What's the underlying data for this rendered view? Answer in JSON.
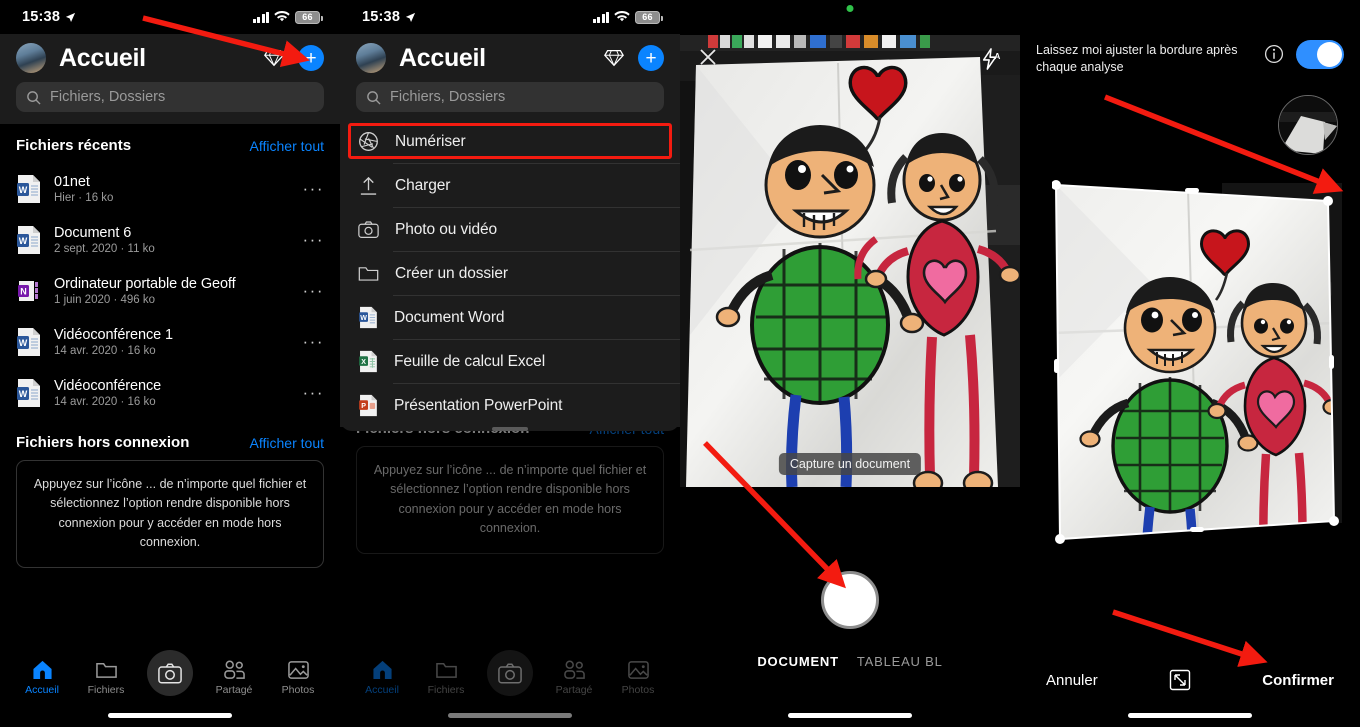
{
  "status_bar": {
    "time": "15:38",
    "battery": "66",
    "location_icon": "location-arrow-icon",
    "signal_icon": "cellular-bars-icon",
    "wifi_icon": "wifi-icon"
  },
  "panel1": {
    "header": {
      "title": "Accueil",
      "avatar": "user-avatar",
      "premium_icon": "diamond-icon",
      "add_label": "+"
    },
    "search": {
      "placeholder": "Fichiers, Dossiers",
      "icon": "search-icon"
    },
    "recent": {
      "title": "Fichiers récents",
      "see_all": "Afficher tout"
    },
    "files": [
      {
        "name": "01net",
        "sub": "Hier · 16 ko",
        "icon": "word-file-icon",
        "more": "···"
      },
      {
        "name": "Document 6",
        "sub": "2 sept. 2020 · 11 ko",
        "icon": "word-file-icon",
        "more": "···"
      },
      {
        "name": "Ordinateur portable de Geoff",
        "sub": "1 juin 2020 · 496 ko",
        "icon": "onenote-file-icon",
        "more": "···"
      },
      {
        "name": "Vidéoconférence 1",
        "sub": "14 avr. 2020 · 16 ko",
        "icon": "word-file-icon",
        "more": "···"
      },
      {
        "name": "Vidéoconférence",
        "sub": "14 avr. 2020 · 16 ko",
        "icon": "word-file-icon",
        "more": "···"
      }
    ],
    "offline": {
      "title": "Fichiers hors connexion",
      "see_all": "Afficher tout",
      "empty_text": "Appuyez sur l’icône ... de n’importe quel fichier et sélectionnez l’option rendre disponible hors connexion pour y accéder en mode hors connexion."
    },
    "tabs": [
      {
        "label": "Accueil",
        "icon": "home-icon",
        "active": true
      },
      {
        "label": "Fichiers",
        "icon": "folder-icon",
        "active": false
      },
      {
        "label": "",
        "icon": "camera-icon",
        "active": false
      },
      {
        "label": "Partagé",
        "icon": "people-icon",
        "active": false
      },
      {
        "label": "Photos",
        "icon": "photo-icon",
        "active": false
      }
    ]
  },
  "panel2": {
    "menu_items": [
      {
        "label": "Numériser",
        "icon": "aperture-scan-icon",
        "highlighted": true
      },
      {
        "label": "Charger",
        "icon": "upload-arrow-icon",
        "highlighted": false
      },
      {
        "label": "Photo ou vidéo",
        "icon": "camera-outline-icon",
        "highlighted": false
      },
      {
        "label": "Créer un dossier",
        "icon": "folder-outline-icon",
        "highlighted": false
      },
      {
        "label": "Document Word",
        "icon": "word-file-icon",
        "highlighted": false
      },
      {
        "label": "Feuille de calcul Excel",
        "icon": "excel-file-icon",
        "highlighted": false
      },
      {
        "label": "Présentation PowerPoint",
        "icon": "powerpoint-file-icon",
        "highlighted": false
      }
    ]
  },
  "panel3": {
    "close_icon": "close-icon",
    "flash_icon": "flash-auto-icon",
    "hint": "Capture un document",
    "shutter": "shutter-button",
    "modes": [
      {
        "label": "DOCUMENT",
        "active": true
      },
      {
        "label": "TABLEAU BL",
        "active": false
      }
    ],
    "recording_indicator": "green-privacy-dot"
  },
  "panel4": {
    "toggle_label": "Laissez moi ajuster la bordure après chaque analyse",
    "info_icon": "info-circle-icon",
    "toggle_state": "on",
    "thumbnail": "capture-thumbnail",
    "cancel": "Annuler",
    "rotate_icon": "resize-arrows-icon",
    "confirm": "Confirmer"
  },
  "colors": {
    "accent": "#0a84ff",
    "highlight": "#f31b10",
    "toggle_on": "#2f8fff",
    "sheet_bg": "#1c1c1c",
    "search_bg": "#323232"
  },
  "annotations": [
    {
      "name": "arrow-to-add-button"
    },
    {
      "name": "arrow-to-shutter-button"
    },
    {
      "name": "arrow-to-crop-corner"
    },
    {
      "name": "arrow-to-confirm-button"
    }
  ]
}
